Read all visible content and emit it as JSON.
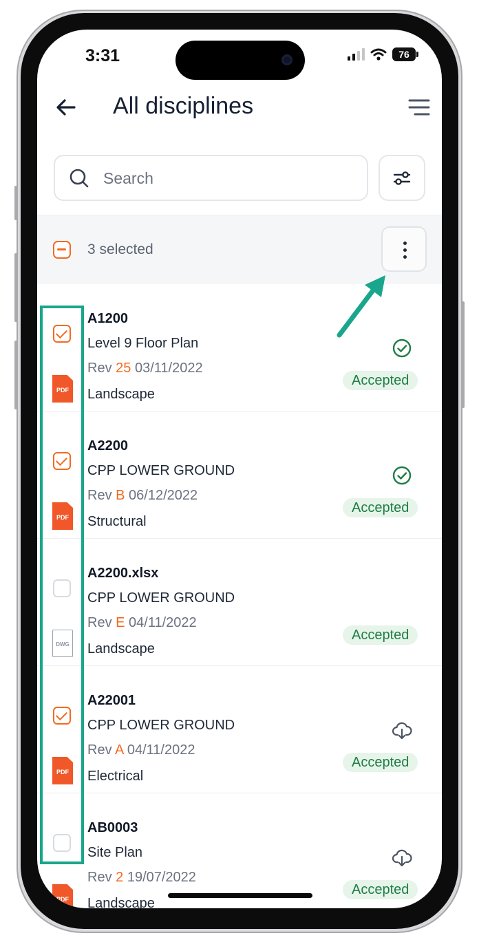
{
  "status_bar": {
    "time": "3:31",
    "battery": "76"
  },
  "header": {
    "title": "All disciplines"
  },
  "search": {
    "placeholder": "Search"
  },
  "selection": {
    "count_label": "3 selected"
  },
  "documents": [
    {
      "code": "A1200",
      "name": "Level 9 Floor Plan",
      "rev_prefix": "Rev",
      "rev": "25",
      "date": "03/11/2022",
      "type": "Landscape",
      "file_icon": "PDF",
      "checked": true,
      "status_icon": "check-circle",
      "status": "Accepted"
    },
    {
      "code": "A2200",
      "name": "CPP LOWER GROUND",
      "rev_prefix": "Rev",
      "rev": "B",
      "date": "06/12/2022",
      "type": "Structural",
      "file_icon": "PDF",
      "checked": true,
      "status_icon": "check-circle",
      "status": "Accepted"
    },
    {
      "code": "A2200.xlsx",
      "name": "CPP LOWER GROUND",
      "rev_prefix": "Rev",
      "rev": "E",
      "date": "04/11/2022",
      "type": "Landscape",
      "file_icon": "DWG",
      "checked": false,
      "status_icon": "none",
      "status": "Accepted"
    },
    {
      "code": "A22001",
      "name": "CPP LOWER GROUND",
      "rev_prefix": "Rev",
      "rev": "A",
      "date": "04/11/2022",
      "type": "Electrical",
      "file_icon": "PDF",
      "checked": true,
      "status_icon": "cloud-download",
      "status": "Accepted"
    },
    {
      "code": "AB0003",
      "name": "Site Plan",
      "rev_prefix": "Rev",
      "rev": "2",
      "date": "19/07/2022",
      "type": "Landscape",
      "file_icon": "PDF",
      "checked": false,
      "status_icon": "cloud-download",
      "status": "Accepted"
    }
  ],
  "colors": {
    "accent": "#f26a21",
    "status_green": "#1e7d45",
    "annotation": "#1aa68c"
  }
}
